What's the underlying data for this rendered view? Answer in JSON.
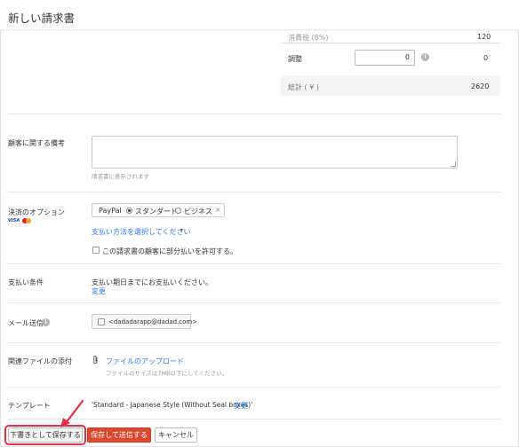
{
  "header": {
    "title": "新しい請求書"
  },
  "totals": {
    "tax_label": "消費税 (8%)",
    "tax_value": "120",
    "adjustment_label": "調整",
    "adjustment_input": "0",
    "adjustment_value": "0",
    "total_label": "総計 ( ¥ )",
    "total_value": "2620"
  },
  "notes": {
    "label": "顧客に関する備考",
    "hint": "請求書に表示されます"
  },
  "payment": {
    "label": "決済のオプション",
    "card_brand": "VISA",
    "gateway": "PayPal",
    "option_standard": "スタンダード",
    "option_business": "ビジネス",
    "remove_glyph": "×",
    "select_method_link": "支払い方法を選択してください",
    "select_caret": "▾",
    "partial_payment_text": "この請求書の顧客に部分払いを許可する。"
  },
  "terms": {
    "label": "支払い条件",
    "text": "支払い期日までにお支払いください。",
    "change_link": "変更"
  },
  "email": {
    "label": "メール送信",
    "address": "<dadadarapp@dadad.com>"
  },
  "attachments": {
    "label": "関連ファイルの添付",
    "upload_link": "ファイルのアップロード",
    "hint": "ファイルのサイズは7MB以下にしてください。"
  },
  "template": {
    "label": "テンプレート",
    "value": "'Standard - Japanese Style (Without Seal boxes)'",
    "change_link": "変更"
  },
  "actions": {
    "save_draft": "下書きとして保存する",
    "save_send": "保存して送信する",
    "cancel": "キャンセル"
  },
  "colors": {
    "primary_button": "#d9492f",
    "link": "#2c7be5",
    "annotation": "#e0304a"
  },
  "icons": {
    "info": "info-icon",
    "paperclip": "paperclip-icon",
    "annotation_arrow": "arrow-annotation-icon"
  }
}
